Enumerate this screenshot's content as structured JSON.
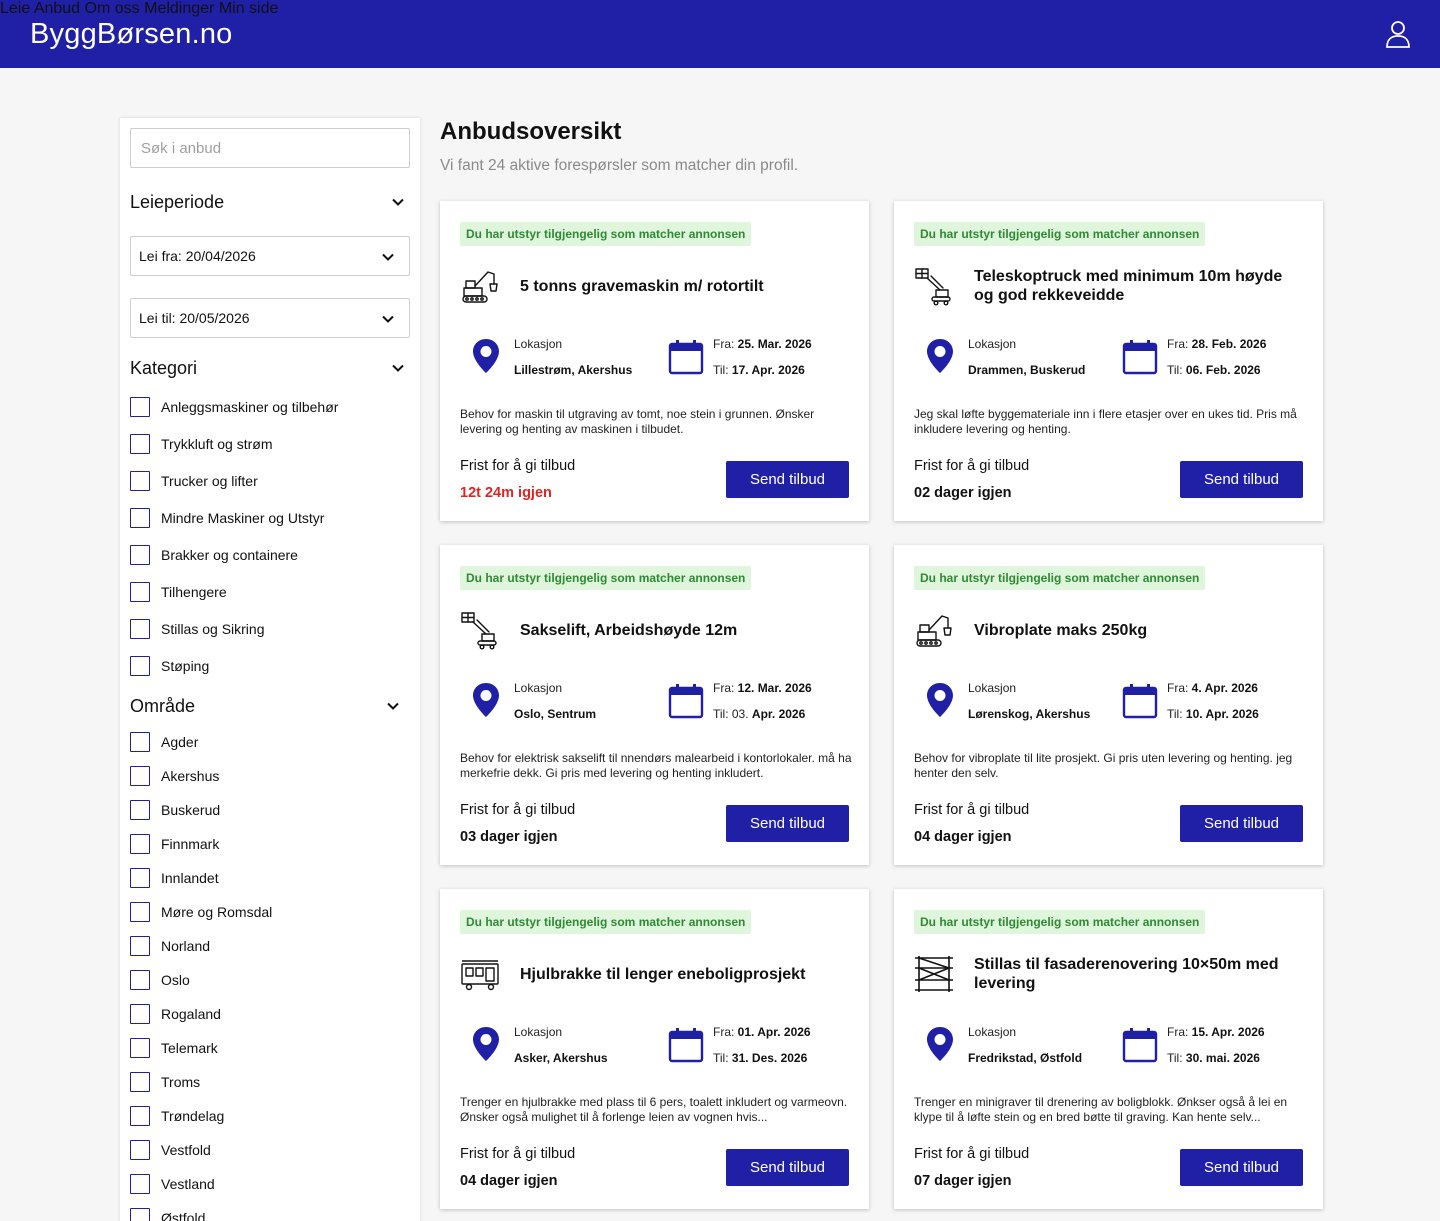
{
  "header": {
    "logo": "ByggBørsen.no",
    "nav": [
      "Leie",
      "Anbud",
      "Om oss",
      "Meldinger",
      "Min side"
    ],
    "user_icon": "user-icon"
  },
  "sidebar": {
    "search_placeholder": "Søk i anbud",
    "leieperiode": {
      "title": "Leieperiode",
      "from": "Lei fra: 20/04/2026",
      "to": "Lei til: 20/05/2026"
    },
    "kategori": {
      "title": "Kategori",
      "items": [
        "Anleggsmaskiner og tilbehør",
        "Trykkluft og strøm",
        "Trucker og lifter",
        "Mindre Maskiner og Utstyr",
        "Brakker og containere",
        "Tilhengere",
        "Stillas og Sikring",
        "Støping"
      ]
    },
    "omrade": {
      "title": "Område",
      "items": [
        "Agder",
        "Akershus",
        "Buskerud",
        "Finnmark",
        "Innlandet",
        "Møre og Romsdal",
        "Norland",
        "Oslo",
        "Rogaland",
        "Telemark",
        "Troms",
        "Trøndelag",
        "Vestfold",
        "Vestland",
        "Østfold"
      ]
    }
  },
  "main": {
    "title": "Anbudsoversikt",
    "subtitle": "Vi fant 24 aktive forespørsler som matcher din profil.",
    "colors": {
      "brand": "#1f20a6",
      "match_bg": "#dff5dc",
      "match_text": "#2f8a35",
      "urgent": "#e02424"
    },
    "cards": [
      {
        "badge": "Du har utstyr tilgjengelig som matcher annonsen",
        "icon": "excavator-icon",
        "title": "5 tonns gravemaskin m/ rotortilt",
        "location_label": "Lokasjon",
        "location": "Lillestrøm, Akershus",
        "from_label": "Fra: ",
        "from": "25. Mar. 2026",
        "to_label": "Til: ",
        "to": "17. Apr. 2026",
        "description": "Behov for maskin til utgraving av tomt, noe stein i grunnen. Ønsker levering og henting av maskinen i tilbudet.",
        "deadline_label": "Frist for å gi tilbud",
        "remaining": "12t 24m igjen",
        "urgent": true,
        "button": "Send tilbud"
      },
      {
        "badge": "Du har utstyr tilgjengelig som matcher annonsen",
        "icon": "telehandler-icon",
        "title": "Teleskoptruck med minimum 10m høyde og  god rekkeveidde",
        "location_label": "Lokasjon",
        "location": "Drammen, Buskerud",
        "from_label": "Fra: ",
        "from": "28. Feb. 2026",
        "to_label": "Til: ",
        "to": "06. Feb. 2026",
        "description": "Jeg skal løfte byggemateriale inn i flere etasjer over en ukes tid. Pris må inkludere levering og henting.",
        "deadline_label": "Frist for å gi tilbud",
        "remaining": "02 dager igjen",
        "urgent": false,
        "button": "Send tilbud"
      },
      {
        "badge": "Du har utstyr tilgjengelig som matcher annonsen",
        "icon": "lift-icon",
        "title": "Sakselift, Arbeidshøyde 12m",
        "location_label": "Lokasjon",
        "location": "Oslo, Sentrum",
        "from_label": "Fra: ",
        "from": "12. Mar. 2026",
        "to_label": "Til: 03. ",
        "to": "Apr. 2026",
        "description": "Behov for elektrisk sakselift til nnendørs malearbeid i kontorlokaler. må ha merkefrie dekk. Gi pris med levering og henting inkludert.",
        "deadline_label": "Frist for å gi tilbud",
        "remaining": "03 dager igjen",
        "urgent": false,
        "button": "Send tilbud"
      },
      {
        "badge": "Du har utstyr tilgjengelig som matcher annonsen",
        "icon": "excavator-icon",
        "title": "Vibroplate maks 250kg",
        "location_label": "Lokasjon",
        "location": "Lørenskog, Akershus",
        "from_label": "Fra: ",
        "from": "4. Apr. 2026",
        "to_label": "Til: ",
        "to": "10. Apr. 2026",
        "description": "Behov for vibroplate til lite prosjekt. Gi pris uten levering og henting. jeg henter den selv.",
        "deadline_label": "Frist for å gi tilbud",
        "remaining": "04 dager igjen",
        "urgent": false,
        "button": "Send tilbud"
      },
      {
        "badge": "Du har utstyr tilgjengelig som matcher annonsen",
        "icon": "trailer-icon",
        "title": "Hjulbrakke til lenger eneboligprosjekt",
        "location_label": "Lokasjon",
        "location": "Asker, Akershus",
        "from_label": "Fra: ",
        "from": "01. Apr. 2026",
        "to_label": "Til: ",
        "to": "31. Des. 2026",
        "description": "Trenger en hjulbrakke med plass til 6 pers, toalett inkludert og varmeovn. Ønsker også mulighet til å forlenge leien av vognen hvis...",
        "deadline_label": "Frist for å gi tilbud",
        "remaining": "04 dager igjen",
        "urgent": false,
        "button": "Send tilbud"
      },
      {
        "badge": "Du har utstyr tilgjengelig som matcher annonsen",
        "icon": "scaffold-icon",
        "title": "Stillas til fasaderenovering 10×50m med levering",
        "location_label": "Lokasjon",
        "location": "Fredrikstad, Østfold",
        "from_label": "Fra: ",
        "from": "15. Apr. 2026",
        "to_label": "Til: ",
        "to": "30. mai. 2026",
        "description": "Trenger en minigraver til drenering av boligblokk. Ønkser også å lei en klype til å løfte stein og en bred bøtte til graving. Kan hente selv...",
        "deadline_label": "Frist for å gi tilbud",
        "remaining": "07 dager igjen",
        "urgent": false,
        "button": "Send tilbud"
      }
    ]
  }
}
